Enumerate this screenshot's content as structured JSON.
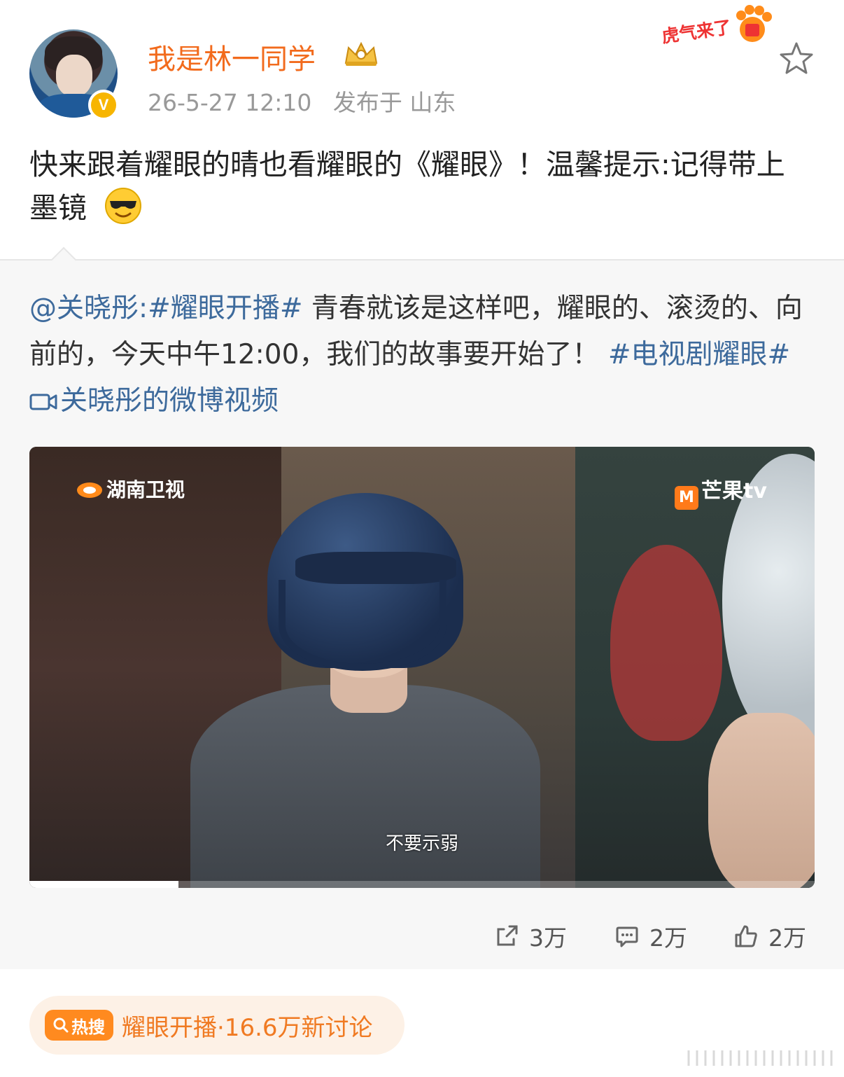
{
  "header": {
    "username": "我是林一同学",
    "date": "26-5-27 12:10",
    "location": "发布于 山东",
    "campaign_badge": "虎气来了",
    "colors": {
      "username": "#f26b1d",
      "verified": "#f7b500"
    }
  },
  "post": {
    "text": "快来跟着耀眼的晴也看耀眼的《耀眼》！温馨提示:记得带上墨镜",
    "emoji": "sunglasses-emoji"
  },
  "repost": {
    "mention": "@关晓彤:",
    "hashtag1": "#耀眼开播#",
    "body": " 青春就该是这样吧，耀眼的、滚烫的、向前的，今天中午12:00，我们的故事要开始了！",
    "hashtag2": "#电视剧耀眼#",
    "video_link": "关晓彤的微博视频"
  },
  "video": {
    "watermark_left": "湖南卫视",
    "watermark_right": "芒果tv",
    "subtitle": "不要示弱",
    "progress": 0.19
  },
  "actions": {
    "repost_count": "3万",
    "comment_count": "2万",
    "like_count": "2万"
  },
  "hot_search": {
    "badge": "热搜",
    "text": "耀眼开播·16.6万新讨论",
    "color": "#ff8a1f"
  }
}
